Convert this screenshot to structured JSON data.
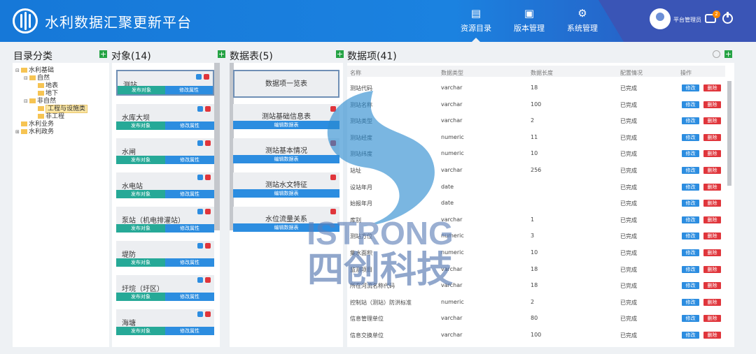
{
  "app": {
    "title": "水利数据汇聚更新平台"
  },
  "nav": [
    {
      "label": "资源目录",
      "icon": "catalog-icon"
    },
    {
      "label": "版本管理",
      "icon": "version-icon"
    },
    {
      "label": "系统管理",
      "icon": "gear-icon"
    }
  ],
  "user": {
    "name": "平台管理员",
    "badge": "2"
  },
  "sections": {
    "catalog": "目录分类",
    "objects": "对象(14)",
    "tables": "数据表(5)",
    "items": "数据项(41)"
  },
  "tree": [
    {
      "label": "水利基础",
      "depth": 0,
      "toggle": "⊟"
    },
    {
      "label": "自然",
      "depth": 1,
      "toggle": "⊟"
    },
    {
      "label": "地表",
      "depth": 2,
      "toggle": ""
    },
    {
      "label": "地下",
      "depth": 2,
      "toggle": ""
    },
    {
      "label": "非自然",
      "depth": 1,
      "toggle": "⊟"
    },
    {
      "label": "工程与设施类",
      "depth": 2,
      "toggle": "",
      "selected": true
    },
    {
      "label": "非工程",
      "depth": 2,
      "toggle": ""
    },
    {
      "label": "水利业务",
      "depth": 0,
      "toggle": ""
    },
    {
      "label": "水利政务",
      "depth": 0,
      "toggle": "⊞"
    }
  ],
  "object_buttons": {
    "publish": "发布对象",
    "modify": "修改属性"
  },
  "objects": [
    "测站",
    "水库大坝",
    "水闸",
    "水电站",
    "泵站（机电排灌站）",
    "堤防",
    "圩垸（圩区）",
    "海塘"
  ],
  "tables": [
    "数据项一览表",
    "测站基础信息表",
    "测站基本情况",
    "测站水文特征",
    "水位流量关系"
  ],
  "table_button": "编辑数据表",
  "columns": [
    "名称",
    "数据类型",
    "数据长度",
    "配置情况",
    "操作"
  ],
  "rows": [
    {
      "name": "测站代码",
      "type": "varchar",
      "len": "18",
      "status": "已完成"
    },
    {
      "name": "测站名称",
      "type": "varchar",
      "len": "100",
      "status": "已完成"
    },
    {
      "name": "测站类型",
      "type": "varchar",
      "len": "2",
      "status": "已完成"
    },
    {
      "name": "测站经度",
      "type": "numeric",
      "len": "11",
      "status": "已完成"
    },
    {
      "name": "测站纬度",
      "type": "numeric",
      "len": "10",
      "status": "已完成"
    },
    {
      "name": "站址",
      "type": "varchar",
      "len": "256",
      "status": "已完成"
    },
    {
      "name": "设站年月",
      "type": "date",
      "len": "",
      "status": "已完成"
    },
    {
      "name": "始报年月",
      "type": "date",
      "len": "",
      "status": "已完成"
    },
    {
      "name": "库别",
      "type": "varchar",
      "len": "1",
      "status": "已完成"
    },
    {
      "name": "测站方位",
      "type": "numeric",
      "len": "3",
      "status": "已完成"
    },
    {
      "name": "集水面积",
      "type": "numeric",
      "len": "10",
      "status": "已完成"
    },
    {
      "name": "监测项目",
      "type": "varchar",
      "len": "18",
      "status": "已完成"
    },
    {
      "name": "所在河流名称代码",
      "type": "varchar",
      "len": "18",
      "status": "已完成"
    },
    {
      "name": "控制站（测站）防洪标准",
      "type": "numeric",
      "len": "2",
      "status": "已完成"
    },
    {
      "name": "信息管理单位",
      "type": "varchar",
      "len": "80",
      "status": "已完成"
    },
    {
      "name": "信息交换单位",
      "type": "varchar",
      "len": "100",
      "status": "已完成"
    }
  ],
  "row_buttons": {
    "edit": "修改",
    "delete": "删除"
  },
  "colors": {
    "header": "#1b82e0",
    "edit": "#2c8de0",
    "delete": "#e0353b",
    "publish": "#26a997",
    "plus": "#25a344"
  },
  "watermark": {
    "text_en": "ISTRONG",
    "text_cn": "四创科技"
  }
}
